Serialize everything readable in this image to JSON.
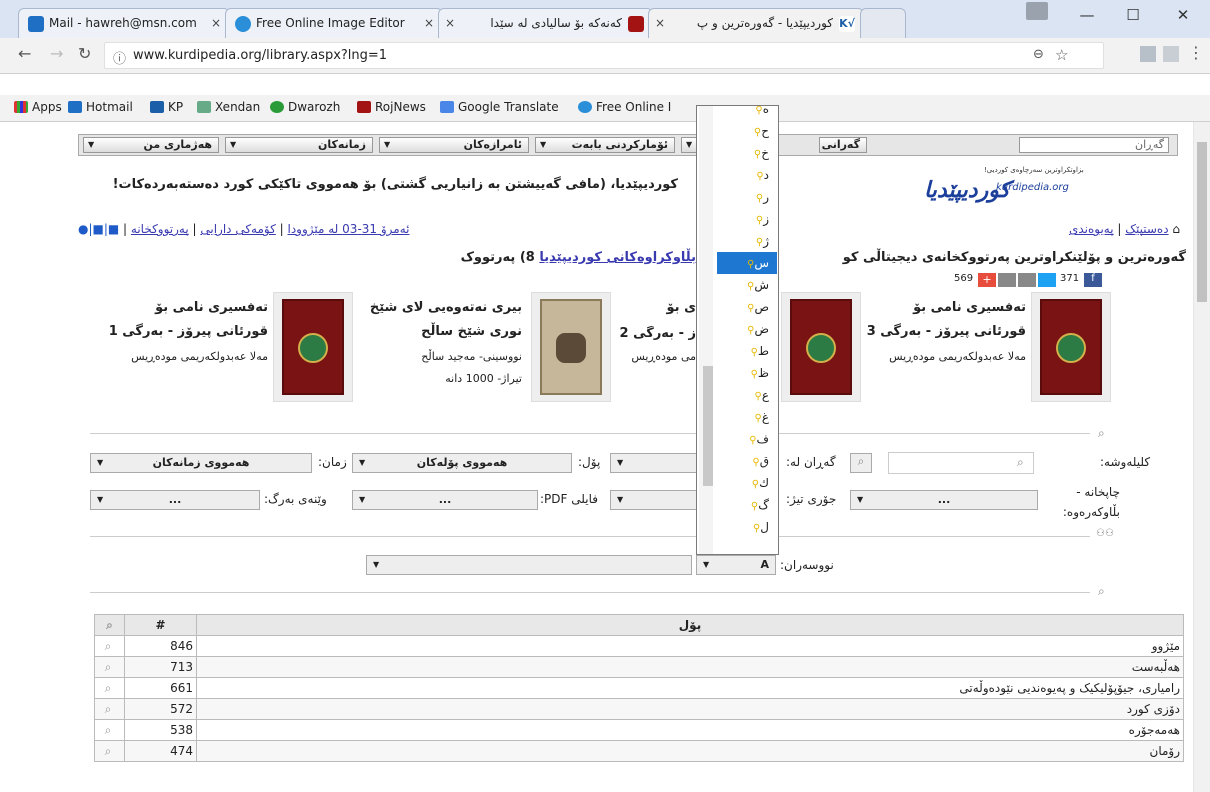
{
  "browser": {
    "tabs": [
      {
        "title": "Mail - hawreh@msn.com",
        "icon": "outlook-icon"
      },
      {
        "title": "Free Online Image Editor",
        "icon": "image-editor-icon"
      },
      {
        "title": "کەنەکە بۆ سالیادی لە سێدا",
        "icon": "rojnews-icon"
      },
      {
        "title": "کوردیپێدیا - گەورەترین و پ",
        "icon": "kurdipedia-icon"
      }
    ],
    "url": "www.kurdipedia.org/library.aspx?lng=1",
    "bookmarks": [
      "Apps",
      "Hotmail",
      "KP",
      "Xendan",
      "Dwarozh",
      "RojNews",
      "Google Translate",
      "Free Online I"
    ]
  },
  "site": {
    "search_placeholder": "گەڕان",
    "menu": [
      "گەرانی",
      "ئۆمارکردنی بابەت",
      "ئامرازەکان",
      "زمانەکان",
      "هەژماری من"
    ],
    "tagline": "کوردیپێدیا، (مافی گەییشتن بە زانیاریی گشتی) بۆ هەمووی تاکێکی کورد دەستەبەردەکات!",
    "logo_sub": "kurdipedia.org",
    "logo_top": "بزاوتکراوترین سەرچاوەی کوردیی!",
    "nav_right": [
      "دەستپێک",
      "پەیوەندی"
    ],
    "nav_left": [
      "ئەمرۆ 31-03 لە مێژوودا",
      "کۆمەکی دارایی",
      "پەرتووکخانە"
    ],
    "headline": "گەورەترین و پۆلێنکراوترین پەرتووکخانەی دیجیتاڵی کو",
    "headline2": "8) پەرتووک",
    "headline_link": "بڵاوکراوەکانی کوردیپێدیا",
    "social_counts": {
      "fb": "371",
      "share": "569"
    }
  },
  "books": [
    {
      "title": "تەفسیری نامی بۆ قورئانی پیرۆز - بەرگی 1",
      "author": "مەلا عەبدولکەریمی مودەڕیس"
    },
    {
      "title": "بیری نەتەوەیی لای شێخ نوری شێخ ساڵح",
      "author": "نووسینی- مەجید ساڵح",
      "extra": "تیراژ- 1000 دانە"
    },
    {
      "title": "ی بۆ",
      "line2": "ز - بەرگی 2",
      "author": "می مودەڕیس"
    },
    {
      "title": "تەفسیری نامی بۆ قورئانی پیرۆز - بەرگی 3",
      "author": "مەلا عەبدولکەریمی مودەڕیس"
    }
  ],
  "filters": {
    "keyword_label": "کلیلەوشە:",
    "search_in_label": "گەڕان لە:",
    "category_label": "پۆل:",
    "category_value": "هەمووی پۆلەکان",
    "language_label": "زمان:",
    "language_value": "هەمووی زمانەکان",
    "printing_label": "چاپخانە - بڵاوکەرەوە:",
    "speed_label": "جۆری تیژ:",
    "pdf_label": "فایلی PDF:",
    "cover_label": "وێنەی بەرگ:",
    "authors_label": "نووسەران:",
    "authors_value": "A",
    "dots": "..."
  },
  "dropdown": {
    "items": [
      "ە",
      "ح",
      "خ",
      "د",
      "ر",
      "ز",
      "ژ",
      "س",
      "ش",
      "ص",
      "ض",
      "ط",
      "ظ",
      "ع",
      "غ",
      "ف",
      "ق",
      "ك",
      "گ",
      "ل"
    ],
    "selected": "س"
  },
  "table": {
    "headers": {
      "count": "#",
      "category": "پۆل"
    },
    "rows": [
      {
        "count": "846",
        "name": "مێژوو"
      },
      {
        "count": "713",
        "name": "هەڵبەست"
      },
      {
        "count": "661",
        "name": "رامیاری، جیۆپۆلیکیک و پەیوەندیی نێودەوڵەتی"
      },
      {
        "count": "572",
        "name": "دۆزی کورد"
      },
      {
        "count": "538",
        "name": "هەمەجۆرە"
      },
      {
        "count": "474",
        "name": "رۆمان"
      }
    ]
  }
}
